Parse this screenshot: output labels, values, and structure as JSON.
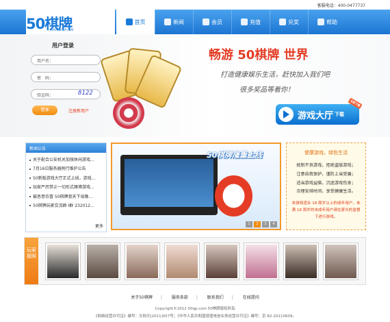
{
  "top": {
    "service_phone": "客服电话：400-0477737"
  },
  "logo": {
    "main": "50棋牌",
    "sub": "WWW.50QP.COM"
  },
  "nav": [
    {
      "label": "首页",
      "icon": "home-icon",
      "active": true
    },
    {
      "label": "新闻",
      "icon": "news-icon"
    },
    {
      "label": "会员",
      "icon": "members-icon"
    },
    {
      "label": "充值",
      "icon": "recharge-icon"
    },
    {
      "label": "兑奖",
      "icon": "gift-icon"
    },
    {
      "label": "帮助",
      "icon": "help-icon"
    }
  ],
  "login": {
    "title": "用户登录",
    "username_label": "用户名：",
    "password_label": "密　码：",
    "captcha_label": "验证码：",
    "captcha_value": "8122",
    "login_button": "登录",
    "register_link": "注册新用户"
  },
  "hero": {
    "headline": "畅游 50棋牌 世界",
    "line2": "打造健康娱乐生活，赶快加入我们吧",
    "line3": "很多奖品等着你！",
    "hall_button": "游戏大厅",
    "hall_suffix": "下载",
    "hall_tag": "立即下载"
  },
  "news": {
    "title": "新闻公告",
    "items": [
      "关于配合公安机关加强休闲游戏...",
      "7月16日服务器例行维护公告",
      "50新版游戏大厅正式上线，游戏...",
      "玩家严厉禁止一切形式赌博游戏...",
      "被恶意仿冒 50棋牌我天下母像...",
      "50棋牌玩家交流群 I群 232012..."
    ],
    "more": "更多"
  },
  "banner": {
    "title": "50棋牌隆重上线",
    "slides": [
      "1",
      "2",
      "3",
      "4"
    ],
    "active_slide": 2
  },
  "health": {
    "title": "健康游戏，绿色生活",
    "lines": [
      "抵制不良游戏，拒绝盗版游戏；",
      "注意自我保护，谨防上当受骗；",
      "适当游戏益脑，沉迷游戏伤身；",
      "合理安排时间，享受健康生活。"
    ],
    "note": "本游戏适合 18 周岁以上的成年用户，未满 18 周岁的未成年用户请在家长的监督下进行游戏。"
  },
  "gallery": {
    "tag": "玩家靓照",
    "photo_count": 8
  },
  "footer": {
    "links": [
      "关于50棋牌",
      "服务条款",
      "联系我们",
      "在线提问"
    ],
    "copyright": "Copyright©2012 50qp.com 50棋牌版权所有",
    "license": "《网络经营许可证》编号：文网文[2011]057号；《中华人民共和国增值电信业务经营许可证》编号：京 B2-20110609。"
  },
  "colors": {
    "brand_blue": "#1a7ad8",
    "orange": "#f08c10",
    "red": "#e43c25"
  }
}
